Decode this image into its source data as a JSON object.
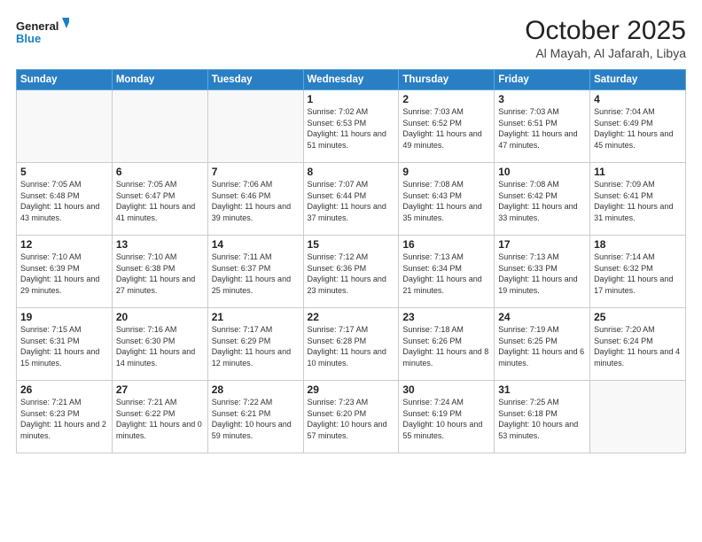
{
  "header": {
    "logo_line1": "General",
    "logo_line2": "Blue",
    "month": "October 2025",
    "location": "Al Mayah, Al Jafarah, Libya"
  },
  "weekdays": [
    "Sunday",
    "Monday",
    "Tuesday",
    "Wednesday",
    "Thursday",
    "Friday",
    "Saturday"
  ],
  "weeks": [
    [
      {
        "day": "",
        "empty": true
      },
      {
        "day": "",
        "empty": true
      },
      {
        "day": "",
        "empty": true
      },
      {
        "day": "1",
        "sunrise": "7:02 AM",
        "sunset": "6:53 PM",
        "daylight": "11 hours and 51 minutes."
      },
      {
        "day": "2",
        "sunrise": "7:03 AM",
        "sunset": "6:52 PM",
        "daylight": "11 hours and 49 minutes."
      },
      {
        "day": "3",
        "sunrise": "7:03 AM",
        "sunset": "6:51 PM",
        "daylight": "11 hours and 47 minutes."
      },
      {
        "day": "4",
        "sunrise": "7:04 AM",
        "sunset": "6:49 PM",
        "daylight": "11 hours and 45 minutes."
      }
    ],
    [
      {
        "day": "5",
        "sunrise": "7:05 AM",
        "sunset": "6:48 PM",
        "daylight": "11 hours and 43 minutes."
      },
      {
        "day": "6",
        "sunrise": "7:05 AM",
        "sunset": "6:47 PM",
        "daylight": "11 hours and 41 minutes."
      },
      {
        "day": "7",
        "sunrise": "7:06 AM",
        "sunset": "6:46 PM",
        "daylight": "11 hours and 39 minutes."
      },
      {
        "day": "8",
        "sunrise": "7:07 AM",
        "sunset": "6:44 PM",
        "daylight": "11 hours and 37 minutes."
      },
      {
        "day": "9",
        "sunrise": "7:08 AM",
        "sunset": "6:43 PM",
        "daylight": "11 hours and 35 minutes."
      },
      {
        "day": "10",
        "sunrise": "7:08 AM",
        "sunset": "6:42 PM",
        "daylight": "11 hours and 33 minutes."
      },
      {
        "day": "11",
        "sunrise": "7:09 AM",
        "sunset": "6:41 PM",
        "daylight": "11 hours and 31 minutes."
      }
    ],
    [
      {
        "day": "12",
        "sunrise": "7:10 AM",
        "sunset": "6:39 PM",
        "daylight": "11 hours and 29 minutes."
      },
      {
        "day": "13",
        "sunrise": "7:10 AM",
        "sunset": "6:38 PM",
        "daylight": "11 hours and 27 minutes."
      },
      {
        "day": "14",
        "sunrise": "7:11 AM",
        "sunset": "6:37 PM",
        "daylight": "11 hours and 25 minutes."
      },
      {
        "day": "15",
        "sunrise": "7:12 AM",
        "sunset": "6:36 PM",
        "daylight": "11 hours and 23 minutes."
      },
      {
        "day": "16",
        "sunrise": "7:13 AM",
        "sunset": "6:34 PM",
        "daylight": "11 hours and 21 minutes."
      },
      {
        "day": "17",
        "sunrise": "7:13 AM",
        "sunset": "6:33 PM",
        "daylight": "11 hours and 19 minutes."
      },
      {
        "day": "18",
        "sunrise": "7:14 AM",
        "sunset": "6:32 PM",
        "daylight": "11 hours and 17 minutes."
      }
    ],
    [
      {
        "day": "19",
        "sunrise": "7:15 AM",
        "sunset": "6:31 PM",
        "daylight": "11 hours and 15 minutes."
      },
      {
        "day": "20",
        "sunrise": "7:16 AM",
        "sunset": "6:30 PM",
        "daylight": "11 hours and 14 minutes."
      },
      {
        "day": "21",
        "sunrise": "7:17 AM",
        "sunset": "6:29 PM",
        "daylight": "11 hours and 12 minutes."
      },
      {
        "day": "22",
        "sunrise": "7:17 AM",
        "sunset": "6:28 PM",
        "daylight": "11 hours and 10 minutes."
      },
      {
        "day": "23",
        "sunrise": "7:18 AM",
        "sunset": "6:26 PM",
        "daylight": "11 hours and 8 minutes."
      },
      {
        "day": "24",
        "sunrise": "7:19 AM",
        "sunset": "6:25 PM",
        "daylight": "11 hours and 6 minutes."
      },
      {
        "day": "25",
        "sunrise": "7:20 AM",
        "sunset": "6:24 PM",
        "daylight": "11 hours and 4 minutes."
      }
    ],
    [
      {
        "day": "26",
        "sunrise": "7:21 AM",
        "sunset": "6:23 PM",
        "daylight": "11 hours and 2 minutes."
      },
      {
        "day": "27",
        "sunrise": "7:21 AM",
        "sunset": "6:22 PM",
        "daylight": "11 hours and 0 minutes."
      },
      {
        "day": "28",
        "sunrise": "7:22 AM",
        "sunset": "6:21 PM",
        "daylight": "10 hours and 59 minutes."
      },
      {
        "day": "29",
        "sunrise": "7:23 AM",
        "sunset": "6:20 PM",
        "daylight": "10 hours and 57 minutes."
      },
      {
        "day": "30",
        "sunrise": "7:24 AM",
        "sunset": "6:19 PM",
        "daylight": "10 hours and 55 minutes."
      },
      {
        "day": "31",
        "sunrise": "7:25 AM",
        "sunset": "6:18 PM",
        "daylight": "10 hours and 53 minutes."
      },
      {
        "day": "",
        "empty": true
      }
    ]
  ]
}
